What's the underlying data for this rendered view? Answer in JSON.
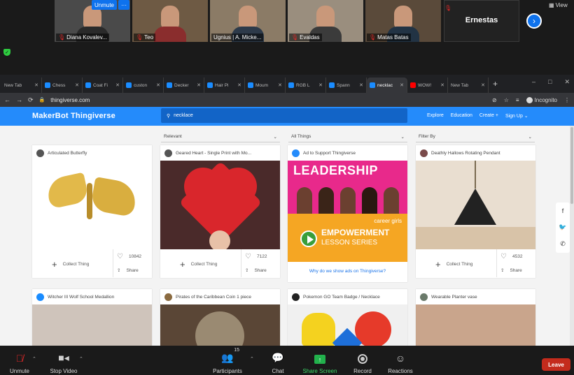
{
  "zoom": {
    "participants_strip": [
      {
        "name": "Diana Kovalev...",
        "muted": true,
        "bg": "#b7a48b",
        "shirt": "#2a2a2a"
      },
      {
        "name": "Teo",
        "muted": true,
        "bg": "#6e5a44",
        "shirt": "#8a2d2d"
      },
      {
        "name": "Ugnius | A. Micke...",
        "muted": false,
        "bg": "#8b7b66",
        "shirt": "#2d3a4a"
      },
      {
        "name": "Evaldas",
        "muted": true,
        "bg": "#9a8e7e",
        "shirt": "#3b3b3b"
      },
      {
        "name": "Matas Batas",
        "muted": true,
        "bg": "#5a4a3a",
        "shirt": "#223344"
      }
    ],
    "unmute_popup": "Unmute",
    "more_popup": "···",
    "ernestas_tile": "Ernestas",
    "view_label": "View",
    "toolbar": {
      "unmute": "Unmute",
      "stop_video": "Stop Video",
      "participants": "Participants",
      "participants_count": "15",
      "chat": "Chat",
      "share_screen": "Share Screen",
      "record": "Record",
      "reactions": "Reactions",
      "leave": "Leave"
    }
  },
  "browser": {
    "tabs": [
      {
        "label": "New Tab",
        "icon": "none"
      },
      {
        "label": "Chess",
        "icon": "tv"
      },
      {
        "label": "Coat Fi",
        "icon": "tv"
      },
      {
        "label": "custon",
        "icon": "tv"
      },
      {
        "label": "Decker",
        "icon": "tv"
      },
      {
        "label": "Hair Pi",
        "icon": "tv"
      },
      {
        "label": "Moum",
        "icon": "tv"
      },
      {
        "label": "RGB L",
        "icon": "tv"
      },
      {
        "label": "Spann",
        "icon": "tv"
      },
      {
        "label": "necklac",
        "icon": "tv",
        "active": true
      },
      {
        "label": "WOW!",
        "icon": "yt"
      },
      {
        "label": "New Tab",
        "icon": "none"
      }
    ],
    "url": "thingiverse.com",
    "incognito_label": "Incognito"
  },
  "site": {
    "logo": "MakerBot Thingiverse",
    "search_value": "necklace",
    "nav": {
      "explore": "Explore",
      "education": "Education",
      "create": "Create",
      "signup": "Sign Up"
    },
    "filters": {
      "sort": "Relevant",
      "category": "All Things",
      "filter": "Filter By"
    },
    "cards_row1": [
      {
        "title": "Articulated Butterfly",
        "likes": "10842",
        "collect": "Collect Thing",
        "share": "Share"
      },
      {
        "title": "Geared Heart - Single Print with Mo...",
        "likes": "7122",
        "collect": "Collect Thing",
        "share": "Share"
      },
      {
        "title": "Deathly Hallows Rotating Pendant",
        "likes": "4532",
        "collect": "Collect Thing",
        "share": "Share"
      }
    ],
    "ad": {
      "title": "Ad to Support Thingiverse",
      "headline": "LEADERSHIP",
      "brand": "career girls",
      "line1": "EMPOWERMENT",
      "line2": "LESSON SERIES",
      "why": "Why do we show ads on Thingiverse?"
    },
    "cards_row2": [
      {
        "title": "Witcher III Wolf School Medallion"
      },
      {
        "title": "Pirates of the Caribbean Coin 1 piece"
      },
      {
        "title": "Pokemon GO Team Badge / Necklace"
      },
      {
        "title": "Wearable Planter vase"
      }
    ]
  }
}
